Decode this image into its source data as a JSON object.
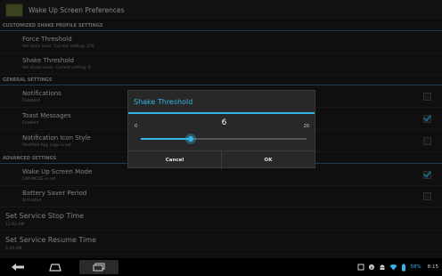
{
  "app": {
    "title": "Wake Up Screen Preferences",
    "icon": "app-logo-icon"
  },
  "sections": {
    "customized": "CUSTOMIZED SHAKE PROFILE SETTINGS",
    "general": "GENERAL SETTINGS",
    "advanced": "ADVANCED SETTINGS"
  },
  "prefs": {
    "force": {
      "title": "Force Threshold",
      "summary": "Set force level. Current setting: 250"
    },
    "shake": {
      "title": "Shake Threshold",
      "summary": "Set shake level. Current setting: 6"
    },
    "notifications": {
      "title": "Notifications",
      "summary": "Disabled",
      "checked": false
    },
    "toast": {
      "title": "Toast Messages",
      "summary": "Enabled",
      "checked": true
    },
    "notif_icon": {
      "title": "Notification Icon Style",
      "summary": "Modified App Logo is set",
      "checked": false
    },
    "wake_mode": {
      "title": "Wake Up Screen Mode",
      "summary": "DIM MODE is set",
      "checked": true
    },
    "battery": {
      "title": "Battery Saver Period",
      "summary": "Activated",
      "checked": false
    },
    "stop_time": {
      "title": "Set Service Stop Time",
      "summary": "12:01 AM"
    },
    "resume_time": {
      "title": "Set Service Resume Time",
      "summary": "5:59 AM"
    }
  },
  "dialog": {
    "title": "Shake Threshold",
    "value": "6",
    "min": "0",
    "max": "20",
    "slider_fraction": 0.3,
    "cancel_label": "Cancel",
    "ok_label": "OK"
  },
  "status": {
    "battery": "58%",
    "time": "8:15"
  },
  "colors": {
    "accent": "#33b5e5",
    "background": "#1c1c1c"
  }
}
